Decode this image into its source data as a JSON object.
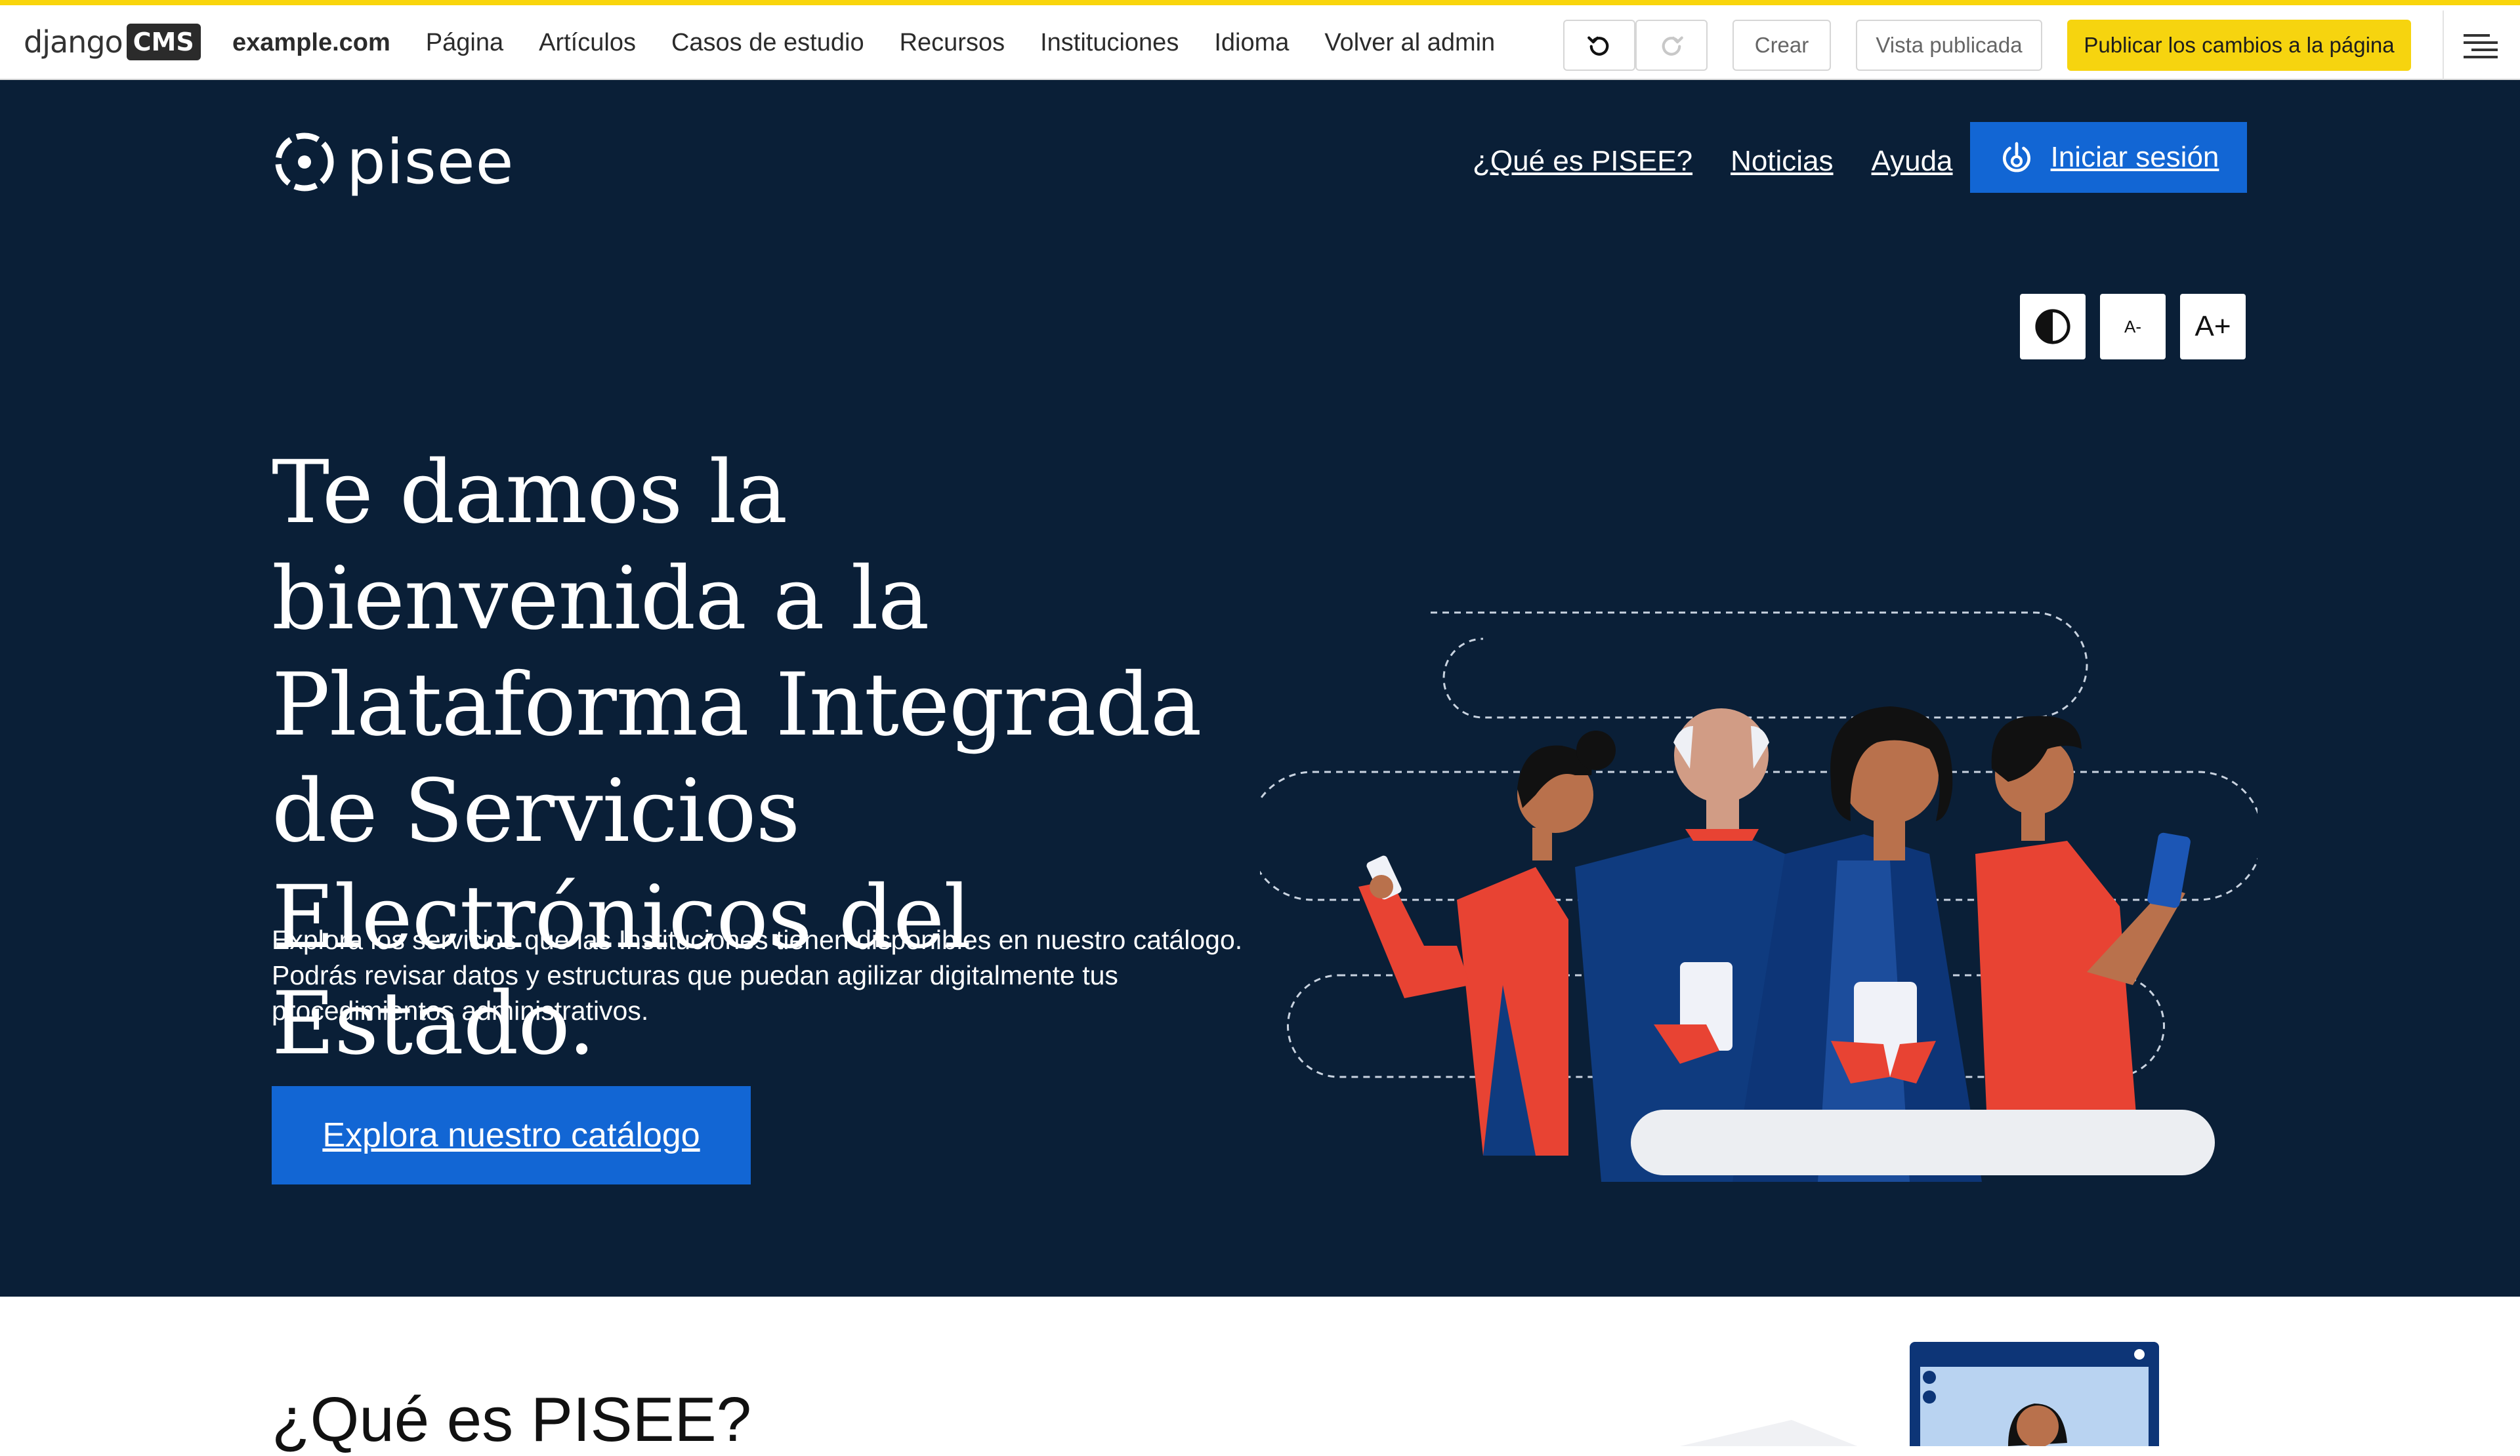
{
  "cms_toolbar": {
    "logo_text": "django",
    "logo_badge": "CMS",
    "menu": [
      "example.com",
      "Página",
      "Artículos",
      "Casos de estudio",
      "Recursos",
      "Instituciones",
      "Idioma",
      "Volver al admin"
    ],
    "create_label": "Crear",
    "view_published_label": "Vista publicada",
    "publish_label": "Publicar los cambios a la página",
    "undo_icon": "undo-icon",
    "redo_icon": "redo-icon",
    "menu_icon": "hamburger-icon",
    "accent_color": "#f6d40f"
  },
  "header": {
    "brand": "pisee",
    "nav": [
      "¿Qué es PISEE?",
      "Noticias",
      "Ayuda"
    ],
    "login_label": "Iniciar sesión"
  },
  "accessibility": {
    "contrast_icon": "contrast-icon",
    "decrease_label": "A-",
    "increase_label": "A+"
  },
  "hero": {
    "title": "Te damos la bienvenida a la Plataforma Integrada de Servicios Electrónicos del Estado.",
    "description": "Explora los servicios que las Instituciones tienen disponibles en nuestro catálogo. Podrás revisar datos y estructuras que puedan agilizar digitalmente tus procedimientos administrativos.",
    "cta_label": "Explora nuestro catálogo",
    "background_color": "#0a1f37",
    "primary_color": "#1266d4"
  },
  "section": {
    "title": "¿Qué es PISEE?"
  }
}
